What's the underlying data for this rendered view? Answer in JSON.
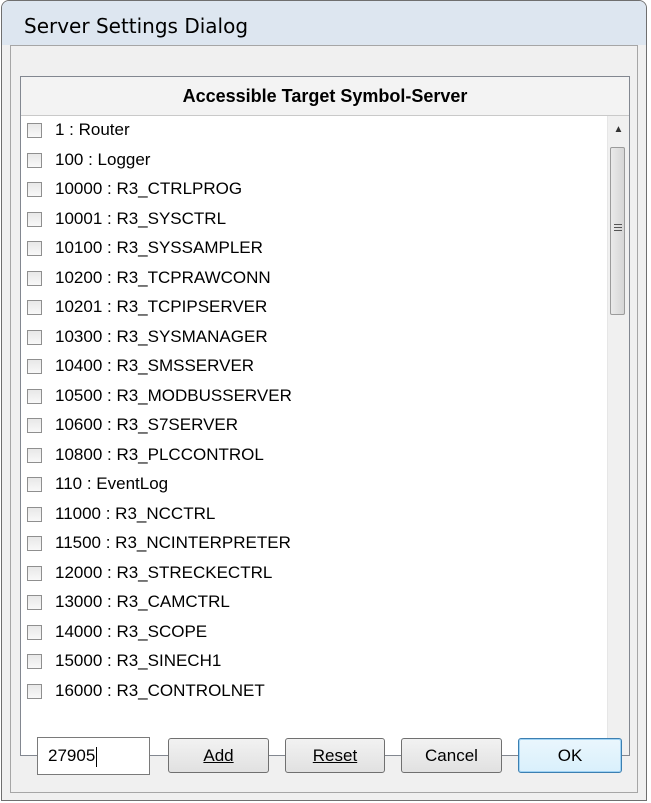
{
  "window": {
    "title": "Server Settings Dialog"
  },
  "list": {
    "header": "Accessible Target Symbol-Server",
    "items": [
      {
        "label": "1 : Router",
        "checked": false
      },
      {
        "label": "100 : Logger",
        "checked": false
      },
      {
        "label": "10000 : R3_CTRLPROG",
        "checked": false
      },
      {
        "label": "10001 : R3_SYSCTRL",
        "checked": false
      },
      {
        "label": "10100 : R3_SYSSAMPLER",
        "checked": false
      },
      {
        "label": "10200 : R3_TCPRAWCONN",
        "checked": false
      },
      {
        "label": "10201 : R3_TCPIPSERVER",
        "checked": false
      },
      {
        "label": "10300 : R3_SYSMANAGER",
        "checked": false
      },
      {
        "label": "10400 : R3_SMSSERVER",
        "checked": false
      },
      {
        "label": "10500 : R3_MODBUSSERVER",
        "checked": false
      },
      {
        "label": "10600 : R3_S7SERVER",
        "checked": false
      },
      {
        "label": "10800 : R3_PLCCONTROL",
        "checked": false
      },
      {
        "label": "110 : EventLog",
        "checked": false
      },
      {
        "label": "11000 : R3_NCCTRL",
        "checked": false
      },
      {
        "label": "11500 : R3_NCINTERPRETER",
        "checked": false
      },
      {
        "label": "12000 : R3_STRECKECTRL",
        "checked": false
      },
      {
        "label": "13000 : R3_CAMCTRL",
        "checked": false
      },
      {
        "label": "14000 : R3_SCOPE",
        "checked": false
      },
      {
        "label": "15000 : R3_SINECH1",
        "checked": false
      },
      {
        "label": "16000 : R3_CONTROLNET",
        "checked": false
      }
    ]
  },
  "port_input": {
    "value": "27905"
  },
  "buttons": {
    "add": "Add",
    "reset": "Reset",
    "cancel": "Cancel",
    "ok": "OK"
  }
}
